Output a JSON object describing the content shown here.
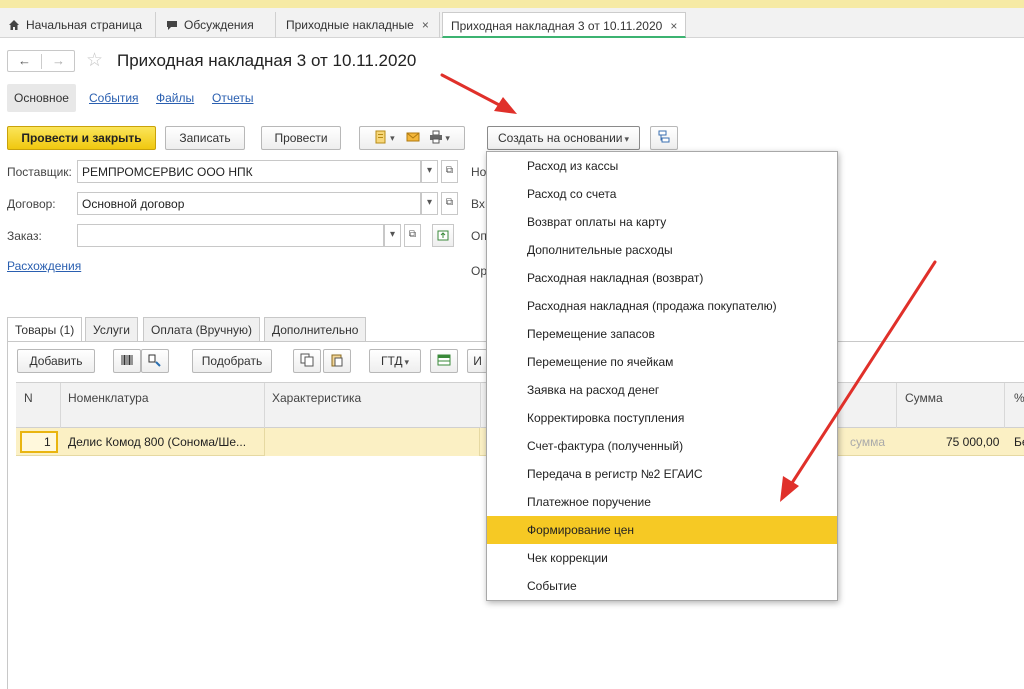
{
  "tabs": [
    {
      "label": "Начальная страница",
      "icon": "home-icon"
    },
    {
      "label": "Обсуждения",
      "icon": "chat-icon"
    },
    {
      "label": "Приходные накладные",
      "close": "×"
    },
    {
      "label": "Приходная накладная 3 от 10.11.2020",
      "close": "×",
      "active": true
    }
  ],
  "header": {
    "back": "←",
    "forward": "→",
    "star": "☆",
    "title": "Приходная накладная 3 от 10.11.2020"
  },
  "subtabs": [
    "Основное",
    "События",
    "Файлы",
    "Отчеты"
  ],
  "toolbar": {
    "post_close": "Провести и закрыть",
    "save": "Записать",
    "post": "Провести",
    "create_based_on": "Создать на основании"
  },
  "form": {
    "supplier_label": "Поставщик:",
    "supplier_value": "РЕМПРОМСЕРВИС ООО НПК",
    "contract_label": "Договор:",
    "contract_value": "Основной договор",
    "order_label": "Заказ:",
    "order_value": "",
    "discrepancies_link": "Расхождения",
    "right_labels": [
      "Но",
      "Вх",
      "Оп",
      "Ор"
    ]
  },
  "lower_tabs": [
    "Товары (1)",
    "Услуги",
    "Оплата (Вручную)",
    "Дополнительно"
  ],
  "items_toolbar": {
    "add": "Добавить",
    "select": "Подобрать",
    "gtd": "ГТД",
    "more": "И"
  },
  "grid": {
    "columns": [
      "N",
      "Номенклатура",
      "Характеристика",
      "Сумма",
      "%"
    ],
    "rows": [
      {
        "n": "1",
        "item": "Делис Комод 800 (Сонома/Ше...",
        "sum_hint": "сумма",
        "sum": "75 000,00",
        "pct": "Бе"
      }
    ]
  },
  "menu": {
    "items": [
      "Расход из кассы",
      "Расход со счета",
      "Возврат оплаты на карту",
      "Дополнительные расходы",
      "Расходная накладная (возврат)",
      "Расходная накладная (продажа покупателю)",
      "Перемещение запасов",
      "Перемещение по ячейкам",
      "Заявка на расход денег",
      "Корректировка поступления",
      "Счет-фактура (полученный)",
      "Передача в регистр №2 ЕГАИС",
      "Платежное поручение",
      "Формирование цен",
      "Чек коррекции",
      "Событие"
    ],
    "highlighted_index": 13
  },
  "colors": {
    "primary_button": "#f0c80f",
    "menu_highlight": "#f6c924",
    "row_highlight": "#fbf0c4",
    "link": "#2a5fb0",
    "arrow": "#e0302a",
    "active_tab_underline": "#3cb371"
  }
}
